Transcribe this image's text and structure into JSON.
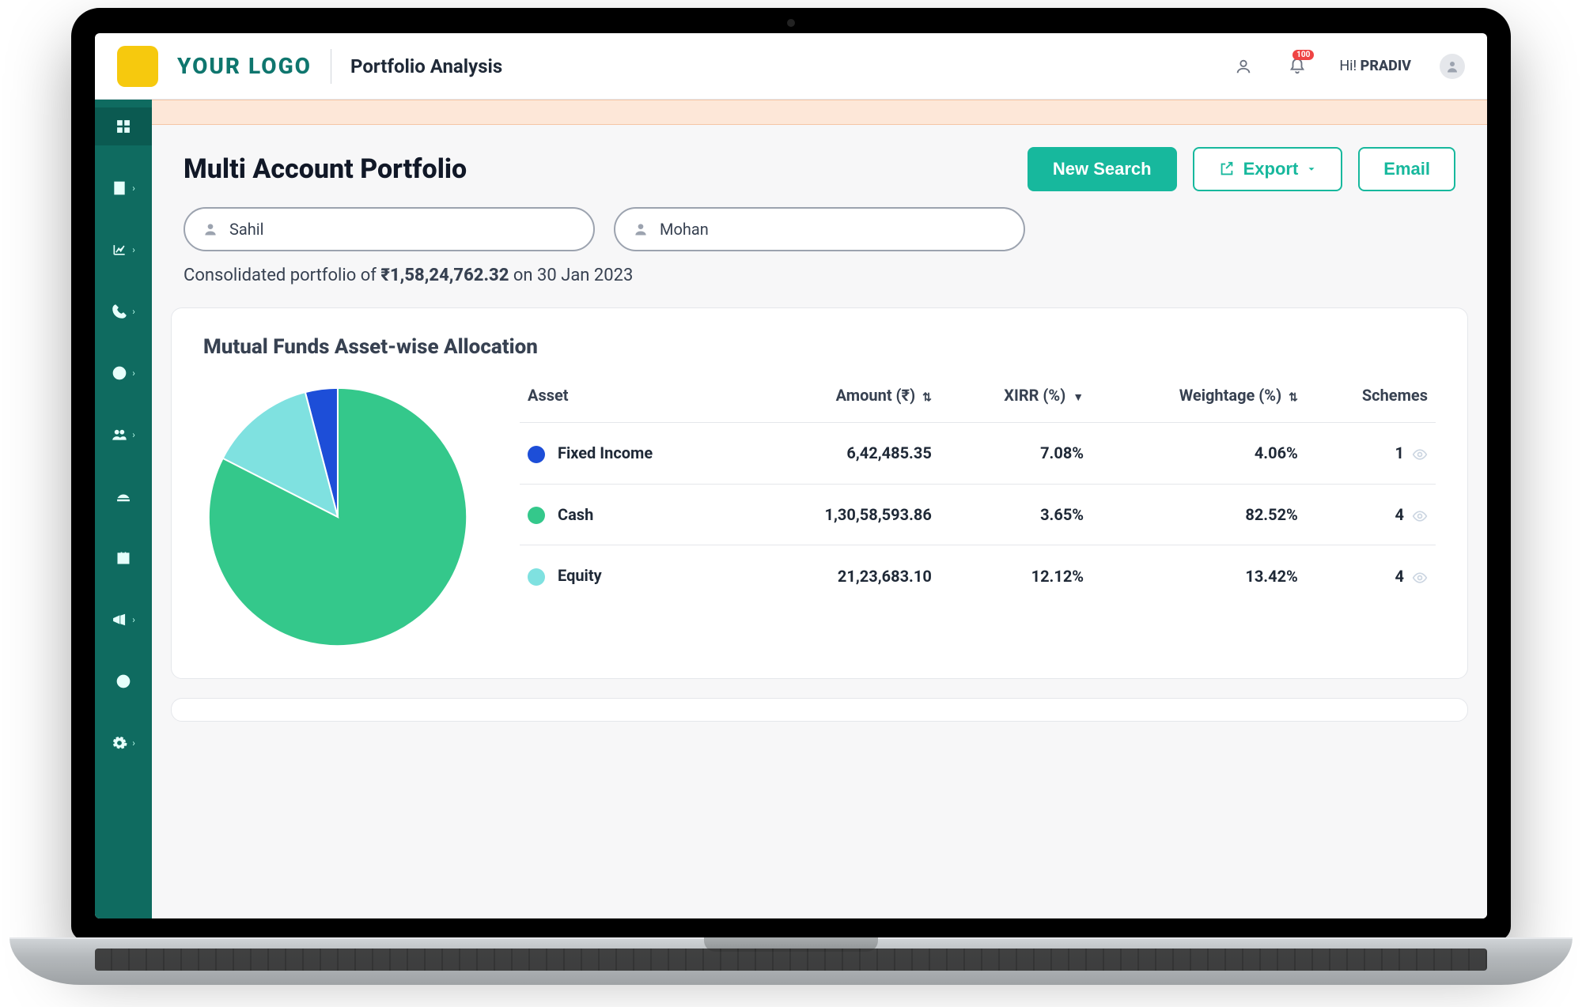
{
  "header": {
    "brand": "YOUR LOGO",
    "page_title": "Portfolio Analysis",
    "notification_badge": "100",
    "greeting_prefix": "Hi! ",
    "user_name": "PRADIV"
  },
  "page": {
    "heading": "Multi Account Portfolio",
    "new_search_label": "New Search",
    "export_label": "Export",
    "email_label": "Email"
  },
  "accounts": [
    "Sahil",
    "Mohan"
  ],
  "summary": {
    "prefix": "Consolidated portfolio of ",
    "amount": "₹1,58,24,762.32",
    "suffix": " on 30 Jan 2023"
  },
  "allocation_card": {
    "title": "Mutual Funds Asset-wise Allocation",
    "columns": {
      "asset": "Asset",
      "amount": "Amount (₹)",
      "xirr": "XIRR (%)",
      "weightage": "Weightage (%)",
      "schemes": "Schemes"
    },
    "rows": [
      {
        "color": "#1d4ed8",
        "asset": "Fixed Income",
        "amount": "6,42,485.35",
        "xirr": "7.08%",
        "weightage": "4.06%",
        "schemes": "1"
      },
      {
        "color": "#34c88b",
        "asset": "Cash",
        "amount": "1,30,58,593.86",
        "xirr": "3.65%",
        "weightage": "82.52%",
        "schemes": "4"
      },
      {
        "color": "#7fe1e0",
        "asset": "Equity",
        "amount": "21,23,683.10",
        "xirr": "12.12%",
        "weightage": "13.42%",
        "schemes": "4"
      }
    ]
  },
  "chart_data": {
    "type": "pie",
    "title": "Mutual Funds Asset-wise Allocation",
    "series": [
      {
        "name": "Fixed Income",
        "value": 4.06,
        "color": "#1d4ed8"
      },
      {
        "name": "Cash",
        "value": 82.52,
        "color": "#34c88b"
      },
      {
        "name": "Equity",
        "value": 13.42,
        "color": "#7fe1e0"
      }
    ]
  }
}
